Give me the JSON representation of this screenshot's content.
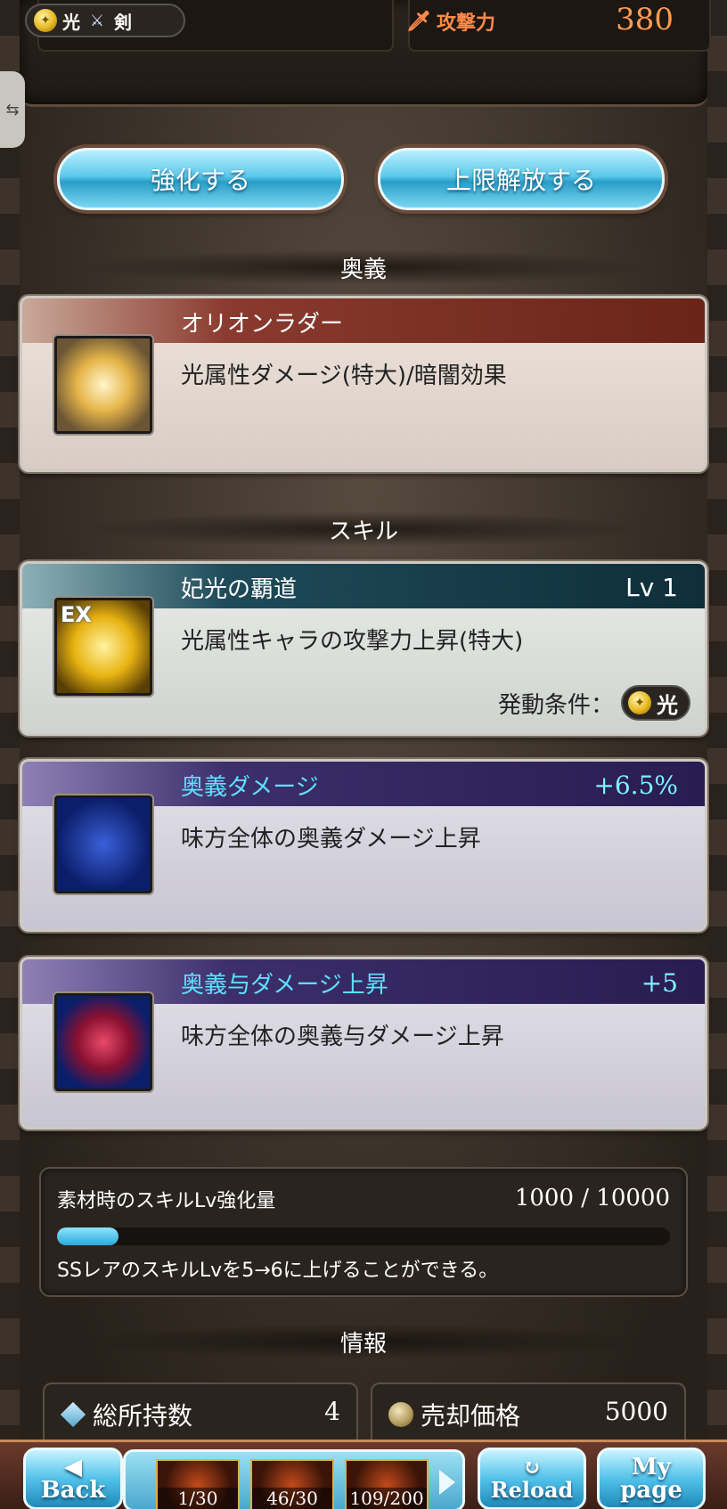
{
  "header": {
    "element": "光",
    "weapon_type": "剣",
    "attack_label": "攻撃力",
    "attack_value": "380"
  },
  "actions": {
    "enhance": "強化する",
    "uncap": "上限解放する"
  },
  "sections": {
    "ougi": "奥義",
    "skill": "スキル",
    "info": "情報"
  },
  "ougi": {
    "name": "オリオンラダー",
    "desc": "光属性ダメージ(特大)/暗闇効果",
    "icon": "crossed-swords-icon"
  },
  "skills": [
    {
      "name": "妃光の覇道",
      "level": "Lv 1",
      "desc": "光属性キャラの攻撃力上昇(特大)",
      "condition_label": "発動条件：",
      "condition_value": "光",
      "icon": "ex-light-skill-icon"
    },
    {
      "name": "奥義ダメージ",
      "value": "+6.5%",
      "desc": "味方全体の奥義ダメージ上昇",
      "icon": "blue-crossed-swords-icon"
    },
    {
      "name": "奥義与ダメージ上昇",
      "value": "+5",
      "desc": "味方全体の奥義与ダメージ上昇",
      "icon": "red-crossed-swords-icon"
    }
  ],
  "material": {
    "title": "素材時のスキルLv強化量",
    "value": "1000 / 10000",
    "progress": 0.1,
    "note": "SSレアのスキルLvを5→6に上げることができる。"
  },
  "info": {
    "owned_label": "総所持数",
    "owned_value": "4",
    "sell_label": "売却価格",
    "sell_value": "5000"
  },
  "nav": {
    "back_top": "◀",
    "back": "Back",
    "reload_top": "↻",
    "reload": "Reload",
    "mypage_top": "My",
    "mypage": "page",
    "gauges": [
      "1/30",
      "46/30",
      "109/200"
    ]
  },
  "colors": {
    "accent_cyan": "#5cc8ea",
    "attack_orange": "#ff8a4a",
    "skill_purple": "#3c2f6a"
  }
}
